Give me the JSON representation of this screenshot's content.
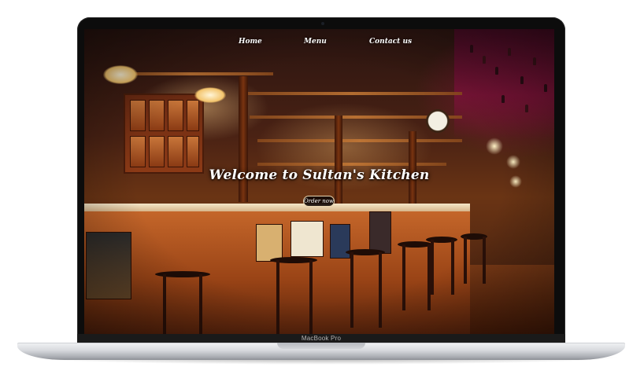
{
  "device": {
    "model_label": "MacBook Pro"
  },
  "site": {
    "nav": {
      "items": [
        {
          "label": "Home"
        },
        {
          "label": "Menu"
        },
        {
          "label": "Contact us"
        }
      ]
    },
    "hero": {
      "title": "Welcome to Sultan's Kitchen",
      "cta_label": "Order now",
      "background_icon": "bar-interior-photo"
    }
  },
  "colors": {
    "nav_text": "#ffffff",
    "hero_text": "#ffffff",
    "button_bg": "#140a06",
    "laptop_bezel": "#0c0c0c",
    "laptop_body": "#d7d9dd"
  }
}
